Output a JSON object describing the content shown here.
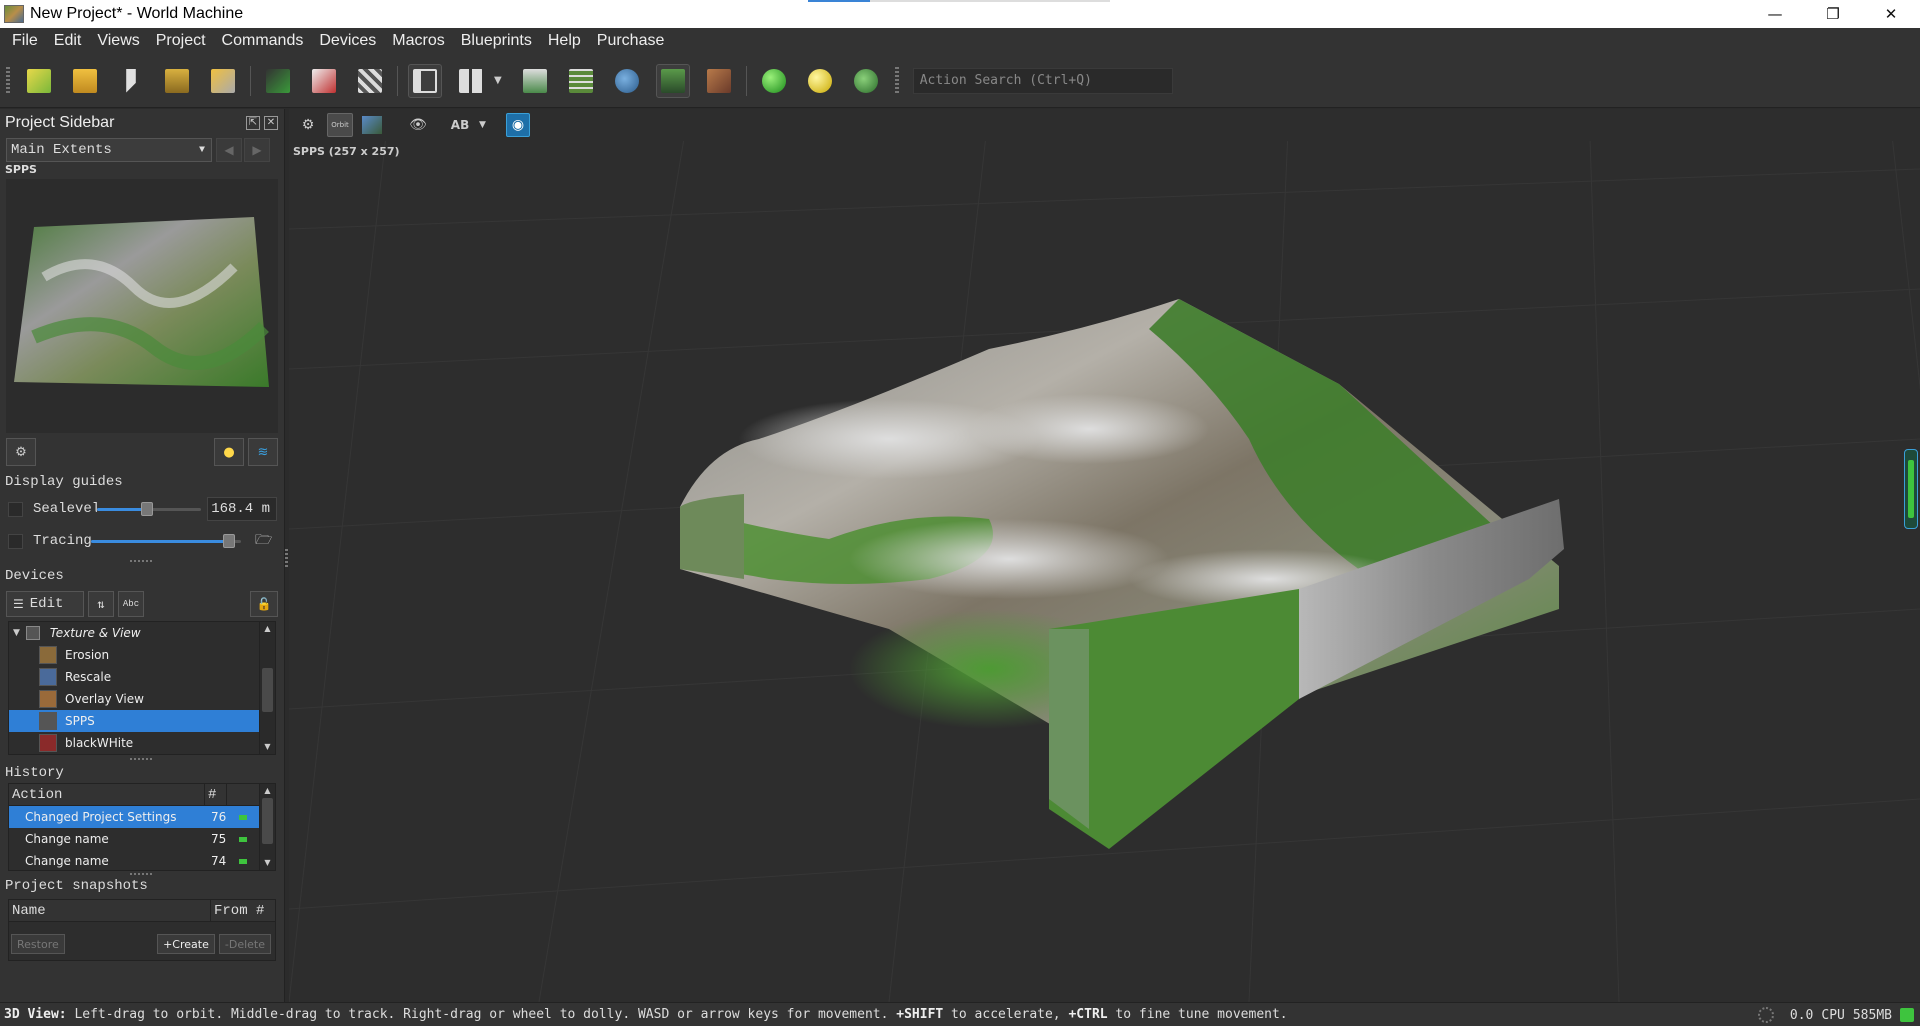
{
  "window": {
    "title": "New Project* - World Machine",
    "minimize": "—",
    "restore": "❐",
    "close": "✕"
  },
  "menu": [
    "File",
    "Edit",
    "Views",
    "Project",
    "Commands",
    "Devices",
    "Macros",
    "Blueprints",
    "Help",
    "Purchase"
  ],
  "toolbar": {
    "search_placeholder": "Action Search (Ctrl+Q)"
  },
  "sidebar": {
    "title": "Project Sidebar",
    "extents_value": "Main Extents",
    "preview_label": "SPPS",
    "display_guides_title": "Display guides",
    "sealevel_label": "Sealevel",
    "sealevel_value": "168.4 m",
    "sealevel_fraction": 0.48,
    "tracing_label": "Tracing",
    "tracing_fraction": 0.92,
    "devices_title": "Devices",
    "edit_label": "Edit",
    "abc_label": "Abc",
    "device_group": "Texture & View",
    "devices": [
      {
        "name": "Erosion",
        "icon": "erosion-icon",
        "color": "#8a6a3a",
        "selected": false
      },
      {
        "name": "Rescale",
        "icon": "rescale-icon",
        "color": "#4a6a9a",
        "selected": false
      },
      {
        "name": "Overlay View",
        "icon": "overlay-view-icon",
        "color": "#9a6a3a",
        "selected": false
      },
      {
        "name": "SPPS",
        "icon": "output-icon",
        "color": "#555555",
        "selected": true
      },
      {
        "name": "blackWHite",
        "icon": "output-red-icon",
        "color": "#8a2a2a",
        "selected": false
      }
    ],
    "history_title": "History",
    "history_columns": [
      "Action",
      "#"
    ],
    "history": [
      {
        "action": "Changed Project Settings",
        "num": "76",
        "selected": true
      },
      {
        "action": "Change name",
        "num": "75",
        "selected": false
      },
      {
        "action": "Change name",
        "num": "74",
        "selected": false
      }
    ],
    "snapshots_title": "Project snapshots",
    "snapshot_columns": [
      "Name",
      "From #"
    ],
    "restore_label": "Restore",
    "create_label": "+Create",
    "delete_label": "-Delete"
  },
  "viewport": {
    "label": "SPPS (257 x 257)",
    "orbit_label": "Orbit",
    "ab_label": "AB"
  },
  "status": {
    "mode": "3D View:",
    "text1": " Left-drag to orbit. Middle-drag to track. Right-drag or wheel to dolly. WASD or arrow keys for movement. ",
    "shift": "+SHIFT",
    "text2": " to accelerate, ",
    "ctrl": "+CTRL",
    "text3": " to fine tune movement.",
    "cpu_value": "0.0",
    "cpu_label": "CPU",
    "memory": "585MB"
  },
  "colors": {
    "accent": "#2f7fd6",
    "terrain_green": "#3f7a2a",
    "terrain_rock": "#8a8a8a"
  }
}
